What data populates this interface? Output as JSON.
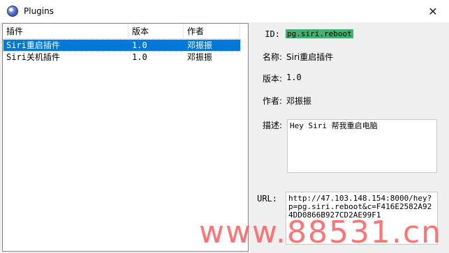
{
  "window": {
    "title": "Plugins",
    "close_glyph": "✕"
  },
  "list": {
    "columns": [
      "插件",
      "版本",
      "作者"
    ],
    "rows": [
      {
        "name": "Siri重启插件",
        "version": "1.0",
        "author": "邓振振",
        "selected": true
      },
      {
        "name": "Siri关机插件",
        "version": "1.0",
        "author": "邓振振",
        "selected": false
      }
    ]
  },
  "details": {
    "id_label": "ID:",
    "id_value": "pg.siri.reboot",
    "name_label": "名称:",
    "name_value": "Siri重启插件",
    "version_label": "版本:",
    "version_value": "1.0",
    "author_label": "作者:",
    "author_value": "邓振振",
    "desc_label": "描述:",
    "desc_value": "Hey Siri 帮我重启电脑",
    "url_label": "URL:",
    "url_value": "http://47.103.148.154:8000/hey?p=pg.siri.reboot&c=F416E2582A924DD0866B927CD2AE99F1"
  },
  "watermark": "www.88531.cn",
  "colors": {
    "selection": "#0078d7",
    "id_highlight": "#3cb371",
    "watermark": "#ff5a5a"
  }
}
